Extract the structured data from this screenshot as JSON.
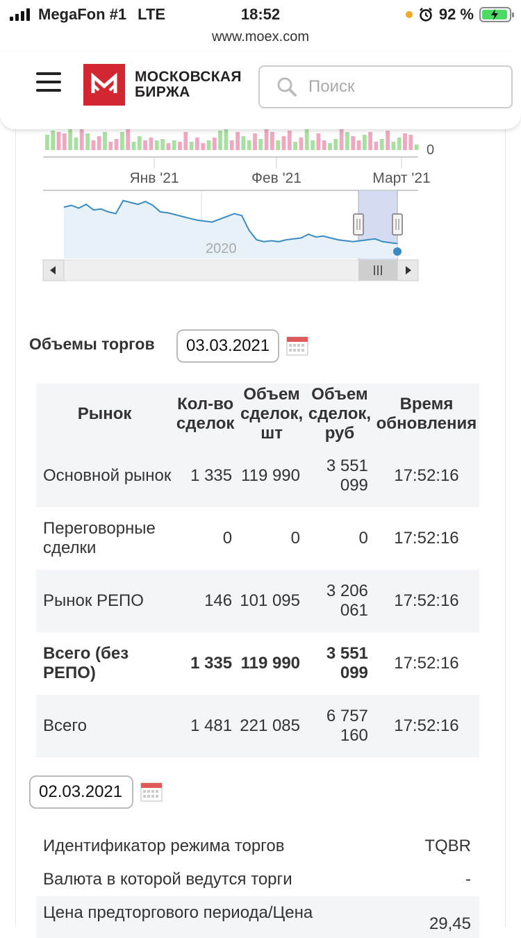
{
  "status_bar": {
    "carrier": "MegaFon #1",
    "network": "LTE",
    "time": "18:52",
    "battery": "92 %"
  },
  "browser": {
    "url": "www.moex.com"
  },
  "header": {
    "logo_line1": "МОСКОВСКАЯ",
    "logo_line2": "БИРЖА",
    "search_placeholder": "Поиск"
  },
  "chart": {
    "volume_axis_label": "0",
    "x_ticks": [
      "Янв '21",
      "Фев '21",
      "Март '21"
    ],
    "navigator_label": "2020",
    "volume_bar_colors": {
      "up": "#a8e0a0",
      "down": "#f0a8c0"
    }
  },
  "chart_data": {
    "type": "area",
    "x_ticks": [
      "Янв '21",
      "Фев '21",
      "Март '21"
    ],
    "navigator_label": "2020",
    "volume_ylabel": "0",
    "navigator_series": [
      55,
      57,
      54,
      58,
      52,
      53,
      50,
      48,
      62,
      60,
      58,
      61,
      57,
      50,
      49,
      47,
      45,
      43,
      41,
      40,
      39,
      42,
      45,
      48,
      46,
      30,
      20,
      18,
      19,
      18,
      20,
      21,
      22,
      26,
      23,
      24,
      22,
      20,
      19,
      18,
      19,
      20,
      21,
      18,
      17,
      16
    ]
  },
  "volumes": {
    "title": "Объемы торгов",
    "date": "03.03.2021",
    "columns": [
      "Рынок",
      "Кол-во сделок",
      "Объем сделок, шт",
      "Объем сделок, руб",
      "Время обновления"
    ],
    "rows": [
      {
        "market": "Основной рынок",
        "deals": "1 335",
        "qty": "119 990",
        "rub": "3 551 099",
        "time": "17:52:16"
      },
      {
        "market": "Переговорные сделки",
        "deals": "0",
        "qty": "0",
        "rub": "0",
        "time": "17:52:16"
      },
      {
        "market": "Рынок РЕПО",
        "deals": "146",
        "qty": "101 095",
        "rub": "3 206 061",
        "time": "17:52:16"
      },
      {
        "market": "Всего (без РЕПО)",
        "deals": "1 335",
        "qty": "119 990",
        "rub": "3 551 099",
        "time": "17:52:16"
      },
      {
        "market": "Всего",
        "deals": "1 481",
        "qty": "221 085",
        "rub": "6 757 160",
        "time": "17:52:16"
      }
    ]
  },
  "info": {
    "date": "02.03.2021",
    "rows": [
      {
        "label": "Идентификатор режима торгов",
        "value": "TQBR"
      },
      {
        "label": "Валюта в которой ведутся торги",
        "value": "-"
      },
      {
        "label": "Цена предторгового периода/Цена",
        "value": "29,45"
      }
    ]
  }
}
